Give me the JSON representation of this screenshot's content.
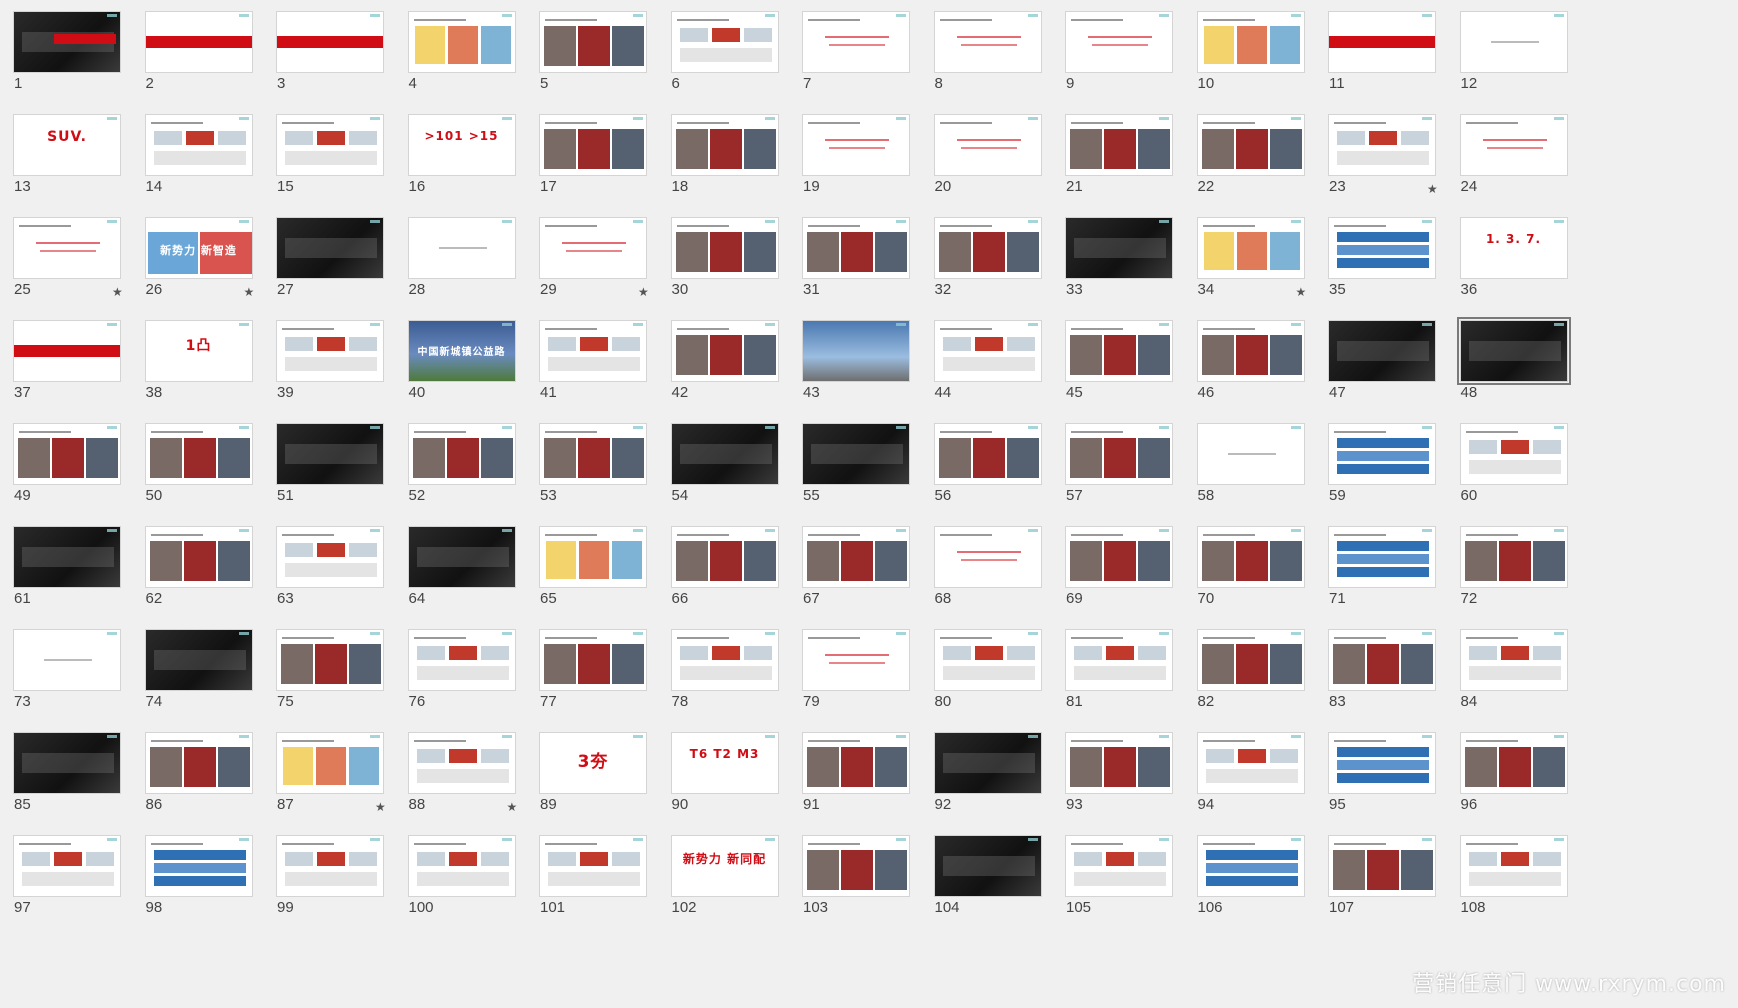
{
  "view": "slide-sorter",
  "watermark_text": "营销任意门 www.rxrym.com",
  "accent_color": "#d00c14",
  "slides": [
    {
      "n": "1",
      "style": "dark",
      "text": "",
      "star": false
    },
    {
      "n": "2",
      "style": "redbar",
      "text": "",
      "star": false
    },
    {
      "n": "3",
      "style": "redbar",
      "text": "",
      "star": false
    },
    {
      "n": "4",
      "style": "colorful",
      "text": "",
      "star": false
    },
    {
      "n": "5",
      "style": "photo",
      "text": "",
      "star": false
    },
    {
      "n": "6",
      "style": "diagram",
      "text": "",
      "star": false
    },
    {
      "n": "7",
      "style": "text",
      "text": "",
      "star": false
    },
    {
      "n": "8",
      "style": "text",
      "text": "",
      "star": false
    },
    {
      "n": "9",
      "style": "text",
      "text": "",
      "star": false
    },
    {
      "n": "10",
      "style": "colorful",
      "text": "",
      "star": false
    },
    {
      "n": "11",
      "style": "redbar",
      "text": "",
      "star": false
    },
    {
      "n": "12",
      "style": "line",
      "text": "",
      "star": false
    },
    {
      "n": "13",
      "style": "bigred",
      "text": "SUV.",
      "star": false
    },
    {
      "n": "14",
      "style": "diagram",
      "text": "",
      "star": false
    },
    {
      "n": "15",
      "style": "diagram",
      "text": "",
      "star": false
    },
    {
      "n": "16",
      "style": "bigmix",
      "text": ">101 >15",
      "star": false
    },
    {
      "n": "17",
      "style": "photo",
      "text": "",
      "star": false
    },
    {
      "n": "18",
      "style": "photo",
      "text": "",
      "star": false
    },
    {
      "n": "19",
      "style": "text",
      "text": "",
      "star": false
    },
    {
      "n": "20",
      "style": "text",
      "text": "",
      "star": false
    },
    {
      "n": "21",
      "style": "photo",
      "text": "",
      "star": false
    },
    {
      "n": "22",
      "style": "photo",
      "text": "",
      "star": false
    },
    {
      "n": "23",
      "style": "diagram",
      "text": "",
      "star": true
    },
    {
      "n": "24",
      "style": "text",
      "text": "",
      "star": false
    },
    {
      "n": "25",
      "style": "text",
      "text": "",
      "star": true
    },
    {
      "n": "26",
      "style": "bluered",
      "text": "新势力 新智造",
      "star": true
    },
    {
      "n": "27",
      "style": "dark",
      "text": "",
      "star": false
    },
    {
      "n": "28",
      "style": "line",
      "text": "",
      "star": false
    },
    {
      "n": "29",
      "style": "text",
      "text": "",
      "star": true
    },
    {
      "n": "30",
      "style": "photo",
      "text": "",
      "star": false
    },
    {
      "n": "31",
      "style": "photo",
      "text": "",
      "star": false
    },
    {
      "n": "32",
      "style": "photo",
      "text": "",
      "star": false
    },
    {
      "n": "33",
      "style": "dark",
      "text": "",
      "star": false
    },
    {
      "n": "34",
      "style": "colorful",
      "text": "",
      "star": true
    },
    {
      "n": "35",
      "style": "blue",
      "text": "",
      "star": false
    },
    {
      "n": "36",
      "style": "bigred",
      "text": "1. 3. 7.",
      "star": false
    },
    {
      "n": "37",
      "style": "redbar",
      "text": "",
      "star": false
    },
    {
      "n": "38",
      "style": "bigred",
      "text": "1凸",
      "star": false
    },
    {
      "n": "39",
      "style": "diagram",
      "text": "",
      "star": false
    },
    {
      "n": "40",
      "style": "city",
      "text": "中国新城镇公益路",
      "star": false
    },
    {
      "n": "41",
      "style": "diagram",
      "text": "",
      "star": false
    },
    {
      "n": "42",
      "style": "photo",
      "text": "",
      "star": false
    },
    {
      "n": "43",
      "style": "sky",
      "text": "",
      "star": false
    },
    {
      "n": "44",
      "style": "diagram",
      "text": "",
      "star": false
    },
    {
      "n": "45",
      "style": "photo",
      "text": "",
      "star": false
    },
    {
      "n": "46",
      "style": "photo",
      "text": "",
      "star": false
    },
    {
      "n": "47",
      "style": "dark",
      "text": "",
      "star": false
    },
    {
      "n": "48",
      "style": "dark",
      "text": "",
      "star": false
    },
    {
      "n": "49",
      "style": "photo",
      "text": "",
      "star": false
    },
    {
      "n": "50",
      "style": "photo",
      "text": "",
      "star": false
    },
    {
      "n": "51",
      "style": "dark",
      "text": "",
      "star": false
    },
    {
      "n": "52",
      "style": "photo",
      "text": "",
      "star": false
    },
    {
      "n": "53",
      "style": "photo",
      "text": "",
      "star": false
    },
    {
      "n": "54",
      "style": "dark",
      "text": "",
      "star": false
    },
    {
      "n": "55",
      "style": "dark",
      "text": "",
      "star": false
    },
    {
      "n": "56",
      "style": "photo",
      "text": "",
      "star": false
    },
    {
      "n": "57",
      "style": "photo",
      "text": "",
      "star": false
    },
    {
      "n": "58",
      "style": "line",
      "text": "",
      "star": false
    },
    {
      "n": "59",
      "style": "blue",
      "text": "",
      "star": false
    },
    {
      "n": "60",
      "style": "diagram",
      "text": "",
      "star": false
    },
    {
      "n": "61",
      "style": "dark",
      "text": "",
      "star": false
    },
    {
      "n": "62",
      "style": "photo",
      "text": "",
      "star": false
    },
    {
      "n": "63",
      "style": "diagram",
      "text": "",
      "star": false
    },
    {
      "n": "64",
      "style": "dark",
      "text": "",
      "star": false
    },
    {
      "n": "65",
      "style": "colorful",
      "text": "",
      "star": false
    },
    {
      "n": "66",
      "style": "photo",
      "text": "",
      "star": false
    },
    {
      "n": "67",
      "style": "photo",
      "text": "",
      "star": false
    },
    {
      "n": "68",
      "style": "text",
      "text": "",
      "star": false
    },
    {
      "n": "69",
      "style": "photo",
      "text": "",
      "star": false
    },
    {
      "n": "70",
      "style": "photo",
      "text": "",
      "star": false
    },
    {
      "n": "71",
      "style": "blue",
      "text": "",
      "star": false
    },
    {
      "n": "72",
      "style": "photo",
      "text": "",
      "star": false
    },
    {
      "n": "73",
      "style": "line",
      "text": "",
      "star": false
    },
    {
      "n": "74",
      "style": "dark",
      "text": "",
      "star": false
    },
    {
      "n": "75",
      "style": "photo",
      "text": "",
      "star": false
    },
    {
      "n": "76",
      "style": "diagram",
      "text": "",
      "star": false
    },
    {
      "n": "77",
      "style": "photo",
      "text": "",
      "star": false
    },
    {
      "n": "78",
      "style": "diagram",
      "text": "",
      "star": false
    },
    {
      "n": "79",
      "style": "text",
      "text": "",
      "star": false
    },
    {
      "n": "80",
      "style": "diagram",
      "text": "",
      "star": false
    },
    {
      "n": "81",
      "style": "diagram",
      "text": "",
      "star": false
    },
    {
      "n": "82",
      "style": "photo",
      "text": "",
      "star": false
    },
    {
      "n": "83",
      "style": "photo",
      "text": "",
      "star": false
    },
    {
      "n": "84",
      "style": "diagram",
      "text": "",
      "star": false
    },
    {
      "n": "85",
      "style": "dark",
      "text": "",
      "star": false
    },
    {
      "n": "86",
      "style": "photo",
      "text": "",
      "star": false
    },
    {
      "n": "87",
      "style": "colorful",
      "text": "",
      "star": true
    },
    {
      "n": "88",
      "style": "diagram",
      "text": "",
      "star": true
    },
    {
      "n": "89",
      "style": "bigmix",
      "text": "3夯",
      "star": false
    },
    {
      "n": "90",
      "style": "bigred",
      "text": "T6 T2 M3",
      "star": false
    },
    {
      "n": "91",
      "style": "photo",
      "text": "",
      "star": false
    },
    {
      "n": "92",
      "style": "dark",
      "text": "",
      "star": false
    },
    {
      "n": "93",
      "style": "photo",
      "text": "",
      "star": false
    },
    {
      "n": "94",
      "style": "diagram",
      "text": "",
      "star": false
    },
    {
      "n": "95",
      "style": "blue",
      "text": "",
      "star": false
    },
    {
      "n": "96",
      "style": "photo",
      "text": "",
      "star": false
    },
    {
      "n": "97",
      "style": "diagram",
      "text": "",
      "star": false
    },
    {
      "n": "98",
      "style": "blue",
      "text": "",
      "star": false
    },
    {
      "n": "99",
      "style": "diagram",
      "text": "",
      "star": false
    },
    {
      "n": "100",
      "style": "diagram",
      "text": "",
      "star": false
    },
    {
      "n": "101",
      "style": "diagram",
      "text": "",
      "star": false
    },
    {
      "n": "102",
      "style": "bigred",
      "text": "新势力 新同配",
      "star": false
    },
    {
      "n": "103",
      "style": "photo",
      "text": "",
      "star": false
    },
    {
      "n": "104",
      "style": "dark",
      "text": "",
      "star": false
    },
    {
      "n": "105",
      "style": "diagram",
      "text": "",
      "star": false
    },
    {
      "n": "106",
      "style": "blue",
      "text": "",
      "star": false
    },
    {
      "n": "107",
      "style": "photo",
      "text": "",
      "star": false
    },
    {
      "n": "108",
      "style": "diagram",
      "text": "",
      "star": false
    }
  ]
}
